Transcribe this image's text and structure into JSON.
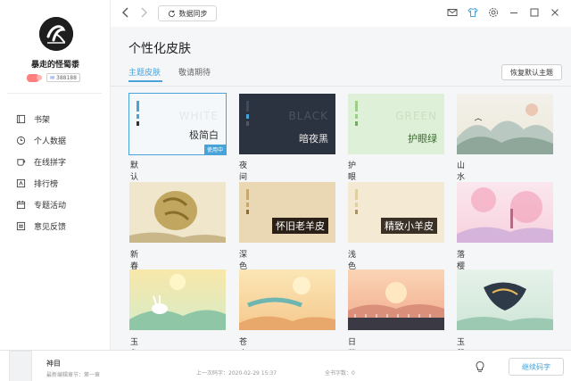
{
  "user": {
    "name": "暴走的怪蜀黍",
    "id": "388188"
  },
  "sidebar": {
    "items": [
      {
        "label": "书架",
        "icon": "book-icon"
      },
      {
        "label": "个人数据",
        "icon": "clock-icon"
      },
      {
        "label": "在线拼字",
        "icon": "cup-icon"
      },
      {
        "label": "排行榜",
        "icon": "rank-icon"
      },
      {
        "label": "专题活动",
        "icon": "calendar-icon"
      },
      {
        "label": "意见反馈",
        "icon": "hash-icon"
      }
    ]
  },
  "toolbar": {
    "sync_label": "数据同步"
  },
  "page": {
    "title": "个性化皮肤",
    "tabs": [
      "主题皮肤",
      "敬请期待"
    ],
    "active_tab": 0,
    "restore_label": "恢复默认主题"
  },
  "themes": [
    {
      "label": "默认主题",
      "overlay": "极简白",
      "bg_text": "WHITE",
      "badge": "使用中",
      "selected": true
    },
    {
      "label": "夜间模式",
      "overlay": "暗夜黑",
      "bg_text": "BLACK"
    },
    {
      "label": "护眼绿",
      "overlay": "护眼绿",
      "bg_text": "GREEN"
    },
    {
      "label": "山水间",
      "overlay": ""
    },
    {
      "label": "新春福到",
      "overlay": ""
    },
    {
      "label": "深色羊皮纸",
      "overlay": "怀旧老羊皮"
    },
    {
      "label": "浅色羊皮纸",
      "overlay": "精致小羊皮"
    },
    {
      "label": "落樱缤纷",
      "overlay": ""
    },
    {
      "label": "玉兔霄月",
      "overlay": ""
    },
    {
      "label": "苍穹之上",
      "overlay": ""
    },
    {
      "label": "日薄西山",
      "overlay": ""
    },
    {
      "label": "玉鼠临风",
      "overlay": ""
    }
  ],
  "bottom": {
    "book_title": "神目",
    "book_sub": "最新编辑章节：第一章",
    "last_sync": "上一次码字：2020-02-29 15:37",
    "word_count": "全书字数：0",
    "continue_label": "继续码字"
  },
  "colors": {
    "accent": "#4aa3d8",
    "main_bg": "#f4f6f8"
  }
}
